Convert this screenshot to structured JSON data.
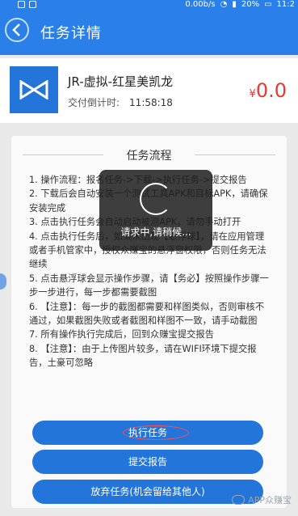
{
  "status_bar": {
    "speed": "0.00b/s",
    "battery": "20%",
    "time": "11:2"
  },
  "app_bar": {
    "title": "任务详情"
  },
  "product": {
    "name": "JR-虚拟-红星美凯龙",
    "countdown_label": "交付倒计时:",
    "countdown_time": "11:58:18",
    "price_symbol": "¥",
    "price_value": "0.0"
  },
  "flow": {
    "title": "任务流程",
    "steps": [
      "1. 操作流程：报名任务->下载->执行任务->提交报告",
      "2. 下载后会自动安装一个测试工具APK和目标APK，请确保安装完成",
      "3. 点击执行任务会自动启动被测APK，请勿手动打开",
      "4. 点击执行任务后，如果未出现【悬浮球】，请在应用管理或者手机管家中，授权众赚宝的悬浮窗权限，否则任务无法继续",
      "5. 点击悬浮球会显示操作步骤，请【务必】按照操作步骤一步一步进行，每一步都需要截图",
      "6. 【注意】：每一步的截图都需要和样图类似，否则审核不通过，如果截图失败或者截图和样图不一致，请手动截图",
      "7. 所有操作执行完成后，回到众赚宝提交报告",
      "8. 【注意】：由于上传图片较多，请在WIFI环境下提交报告，土豪可忽略"
    ]
  },
  "buttons": {
    "execute": "执行任务",
    "submit": "提交报告",
    "abandon": "放弃任务(机会留给其他人)"
  },
  "loading": {
    "text": "请求中,请稍候..."
  },
  "watermark": {
    "text": "APP众赚宝"
  }
}
